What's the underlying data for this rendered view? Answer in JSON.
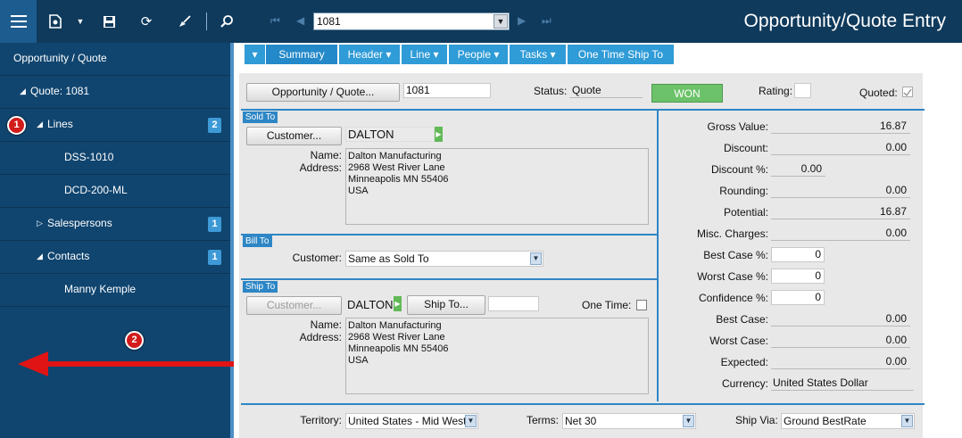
{
  "toolbar": {
    "record_value": "1081",
    "title": "Opportunity/Quote Entry",
    "icons": [
      "menu-icon",
      "new-icon",
      "dropdown-icon",
      "save-icon",
      "refresh-icon",
      "clear-icon",
      "search-icon",
      "first-icon",
      "prev-icon",
      "next-icon",
      "last-icon"
    ]
  },
  "sidebar": {
    "header": "Opportunity / Quote",
    "items": [
      {
        "label": "Quote: 1081"
      },
      {
        "label": "Lines",
        "badge": "2"
      },
      {
        "label": "DSS-1010"
      },
      {
        "label": "DCD-200-ML"
      },
      {
        "label": "Salespersons",
        "badge": "1"
      },
      {
        "label": "Contacts",
        "badge": "1"
      },
      {
        "label": "Manny Kemple"
      }
    ],
    "callout1": "1",
    "callout2": "2"
  },
  "tabs": [
    "Summary",
    "Header",
    "Line",
    "People",
    "Tasks",
    "One Time Ship To"
  ],
  "form": {
    "opp_button": "Opportunity / Quote...",
    "opp_value": "1081",
    "status_label": "Status:",
    "status_value": "Quote",
    "won_button": "WON",
    "rating_label": "Rating:",
    "quoted_label": "Quoted:",
    "sold_to": {
      "section": "Sold To",
      "customer_button": "Customer...",
      "customer_value": "DALTON",
      "name_label": "Name:",
      "address_label": "Address:",
      "address_lines": [
        "Dalton Manufacturing",
        "2968 West River Lane",
        "Minneapolis MN 55406",
        "USA"
      ]
    },
    "bill_to": {
      "section": "Bill To",
      "customer_label": "Customer:",
      "customer_value": "Same as Sold To"
    },
    "ship_to": {
      "section": "Ship To",
      "customer_button": "Customer...",
      "customer_value": "DALTON",
      "ship_to_button": "Ship To...",
      "one_time_label": "One Time:",
      "name_label": "Name:",
      "address_label": "Address:",
      "address_lines": [
        "Dalton Manufacturing",
        "2968 West River Lane",
        "Minneapolis MN 55406",
        "USA"
      ]
    },
    "totals": [
      {
        "label": "Gross Value:",
        "value": "16.87"
      },
      {
        "label": "Discount:",
        "value": "0.00"
      },
      {
        "label": "Discount %:",
        "value": "0.00"
      },
      {
        "label": "Rounding:",
        "value": "0.00"
      },
      {
        "label": "Potential:",
        "value": "16.87"
      },
      {
        "label": "Misc. Charges:",
        "value": "0.00"
      },
      {
        "label": "Best Case %:",
        "value": "0"
      },
      {
        "label": "Worst Case %:",
        "value": "0"
      },
      {
        "label": "Confidence %:",
        "value": "0"
      },
      {
        "label": "Best Case:",
        "value": "0.00"
      },
      {
        "label": "Worst Case:",
        "value": "0.00"
      },
      {
        "label": "Expected:",
        "value": "0.00"
      },
      {
        "label": "Currency:",
        "value": "United States Dollar"
      }
    ],
    "territory_label": "Territory:",
    "territory_value": "United States - Mid West",
    "terms_label": "Terms:",
    "terms_value": "Net 30",
    "ship_via_label": "Ship Via:",
    "ship_via_value": "Ground BestRate"
  }
}
